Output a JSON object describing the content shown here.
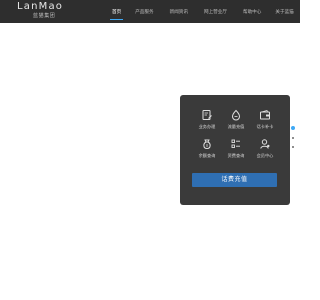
{
  "header": {
    "logo_text": "LanMao",
    "logo_sub": "蓝猫集团",
    "nav": [
      {
        "label": "首页",
        "active": true
      },
      {
        "label": "产品服务",
        "active": false
      },
      {
        "label": "新闻资讯",
        "active": false
      },
      {
        "label": "网上营业厅",
        "active": false
      },
      {
        "label": "帮助中心",
        "active": false
      },
      {
        "label": "关于蓝猫",
        "active": false
      }
    ]
  },
  "service_panel": {
    "items": [
      {
        "label": "业务办理",
        "icon": "document-edit-icon"
      },
      {
        "label": "流量充值",
        "icon": "droplet-icon"
      },
      {
        "label": "话卡补卡",
        "icon": "wallet-icon"
      },
      {
        "label": "余额查询",
        "icon": "money-bag-icon"
      },
      {
        "label": "资费查询",
        "icon": "list-icon"
      },
      {
        "label": "会员中心",
        "icon": "user-settings-icon"
      }
    ],
    "cta_label": "话费充值"
  },
  "pager": {
    "dots": 3,
    "active_index": 0
  },
  "colors": {
    "header_bg": "#2e2e2e",
    "panel_bg": "#3a3a3a",
    "accent": "#2f6fb3",
    "active_dot": "#3fa9f5"
  }
}
